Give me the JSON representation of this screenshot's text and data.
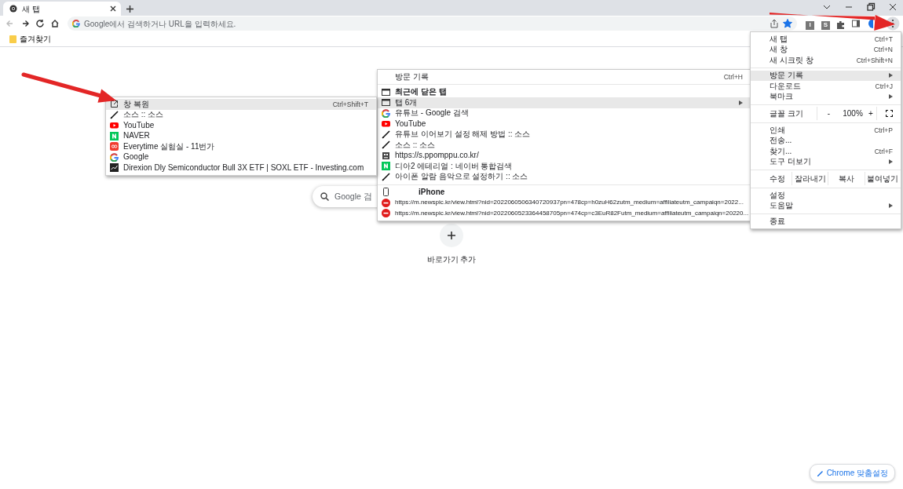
{
  "tab": {
    "title": "새 탭",
    "selected": true
  },
  "toolbar": {
    "omnibox": {
      "placeholder": "Google에서 검색하거나 URL을 입력하세요."
    },
    "bookmarked": true,
    "extensions": [
      {
        "label": "I"
      },
      {
        "label": "S"
      }
    ]
  },
  "bookmarks_bar": [
    {
      "label": "즐겨찾기"
    }
  ],
  "main_menu": [
    {
      "kind": "item",
      "label": "새 탭",
      "shortcut": "Ctrl+T",
      "selected": false
    },
    {
      "kind": "item",
      "label": "새 창",
      "shortcut": "Ctrl+N",
      "selected": false
    },
    {
      "kind": "item",
      "label": "새 시크릿 창",
      "shortcut": "Ctrl+Shift+N",
      "selected": false
    },
    {
      "kind": "separator"
    },
    {
      "kind": "item",
      "label": "방문 기록",
      "submenu": true,
      "selected": true
    },
    {
      "kind": "item",
      "label": "다운로드",
      "shortcut": "Ctrl+J",
      "selected": false
    },
    {
      "kind": "item",
      "label": "북마크",
      "submenu": true,
      "selected": false
    },
    {
      "kind": "separator"
    },
    {
      "kind": "zoom",
      "label": "글꼴 크기",
      "minus": "-",
      "value": "100%",
      "plus": "+"
    },
    {
      "kind": "separator"
    },
    {
      "kind": "item",
      "label": "인쇄",
      "shortcut": "Ctrl+P",
      "selected": false
    },
    {
      "kind": "item",
      "label": "전송...",
      "selected": false
    },
    {
      "kind": "item",
      "label": "찾기...",
      "shortcut": "Ctrl+F",
      "selected": false
    },
    {
      "kind": "item",
      "label": "도구 더보기",
      "submenu": true,
      "selected": false
    },
    {
      "kind": "separator"
    },
    {
      "kind": "edit",
      "label": "수정",
      "buttons": [
        "잘라내기",
        "복사",
        "붙여넣기"
      ]
    },
    {
      "kind": "separator"
    },
    {
      "kind": "item",
      "label": "설정",
      "selected": false
    },
    {
      "kind": "item",
      "label": "도움말",
      "submenu": true,
      "selected": false
    },
    {
      "kind": "separator"
    },
    {
      "kind": "item",
      "label": "종료",
      "selected": false
    }
  ],
  "history_menu": [
    {
      "kind": "item",
      "label": "방문 기록",
      "shortcut": "Ctrl+H",
      "selected": false
    },
    {
      "kind": "separator"
    },
    {
      "kind": "header",
      "label": "최근에 닫은 탭"
    },
    {
      "kind": "item",
      "label": "탭 6개",
      "submenu": true,
      "selected": true
    },
    {
      "kind": "item",
      "label": "유튜브 - Google 검색",
      "selected": false
    },
    {
      "kind": "item",
      "label": "YouTube",
      "selected": false
    },
    {
      "kind": "item",
      "label": "유튜브 이어보기 설정 해제 방법 :: 소스",
      "selected": false
    },
    {
      "kind": "item",
      "label": "소스 :: 소스",
      "selected": false
    },
    {
      "kind": "item",
      "label": "https://s.ppomppu.co.kr/",
      "selected": false
    },
    {
      "kind": "item",
      "label": "디아2 에테리얼 : 네이버 통합검색",
      "selected": false
    },
    {
      "kind": "item",
      "label": "아이폰 알람 음악으로 설정하기 :: 소스",
      "selected": false
    },
    {
      "kind": "separator"
    },
    {
      "kind": "device",
      "label": "iPhone"
    },
    {
      "kind": "synced",
      "label": "https://m.newspic.kr/view.html?nid=2022060506340720937pn=478cp=h0zuH62zutm_medium=affiliateutm_campaiqn=2022...",
      "selected": false
    },
    {
      "kind": "synced",
      "label": "https://m.newspic.kr/view.html?nid=2022060523364458705pn=474cp=c3EuR82Futm_medium=affiliateutm_campaiqn=20220...",
      "selected": false
    }
  ],
  "tabs_menu": [
    {
      "label": "창 복원",
      "shortcut": "Ctrl+Shift+T",
      "selected": true
    },
    {
      "label": "소스 :: 소스",
      "selected": false
    },
    {
      "label": "YouTube",
      "selected": false
    },
    {
      "label": "NAVER",
      "selected": false
    },
    {
      "label": "Everytime 실험실 - 11번가",
      "selected": false
    },
    {
      "label": "Google",
      "selected": false
    },
    {
      "label": "Direxion Dly Semiconductor Bull 3X ETF | SOXL ETF - Investing.com",
      "selected": false
    }
  ],
  "search": {
    "placeholder": "Google 검"
  },
  "shortcut_add": {
    "label": "바로가기 추가"
  },
  "customize": {
    "label": "Chrome 맞춤설정"
  }
}
